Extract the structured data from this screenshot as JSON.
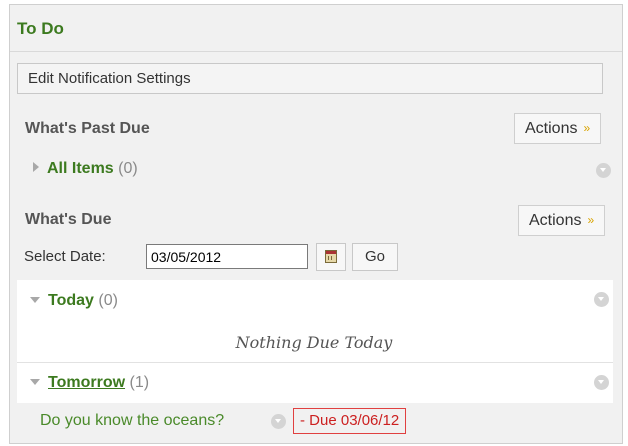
{
  "module": {
    "title": "To Do",
    "edit_notification_label": "Edit Notification Settings"
  },
  "past_due": {
    "heading": "What's Past Due",
    "actions_label": "Actions",
    "all_items_label": "All Items",
    "all_items_count": "(0)"
  },
  "due": {
    "heading": "What's Due",
    "actions_label": "Actions",
    "select_date_label": "Select Date:",
    "date_value": "03/05/2012",
    "go_label": "Go",
    "today_label": "Today",
    "today_count": "(0)",
    "nothing_due": "Nothing Due Today",
    "tomorrow_label": "Tomorrow",
    "tomorrow_count": "(1)",
    "item_title": "Do you know the oceans?",
    "item_due": "- Due 03/06/12"
  },
  "colors": {
    "accent_green": "#3c7a1f",
    "due_red": "#cc2020",
    "actions_chevron": "#d9a400"
  },
  "icons": [
    "chevron-double-down-icon",
    "triangle-right-icon",
    "triangle-down-icon",
    "context-menu-icon",
    "calendar-icon"
  ]
}
